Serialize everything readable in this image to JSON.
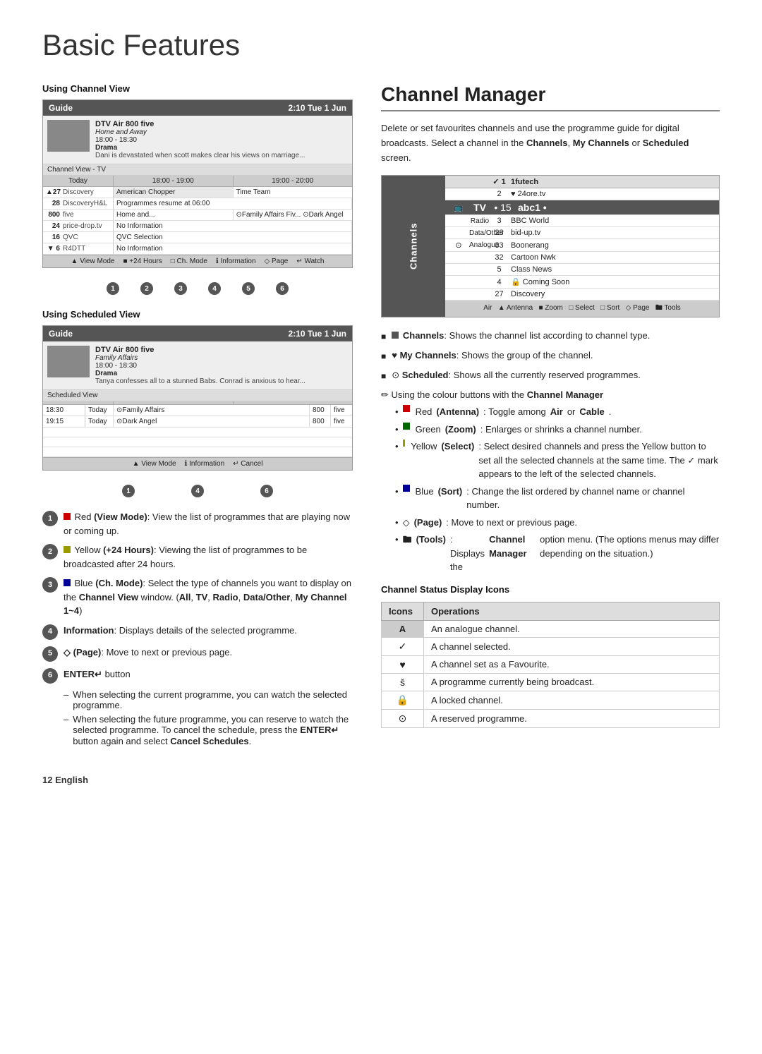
{
  "page": {
    "title": "Basic Features",
    "footer": "12  English"
  },
  "left": {
    "channel_view_label": "Using Channel View",
    "scheduled_view_label": "Using Scheduled View",
    "guide_header": "Guide",
    "guide_time": "2:10 Tue 1 Jun",
    "channel_view_source": "Channel View - TV",
    "time_today": "Today",
    "time1": "18:00 - 19:00",
    "time2": "19:00 - 20:00",
    "channels": [
      {
        "num": "▲ 27",
        "name": "Discovery",
        "prog1": "American Chopper",
        "prog2": "Time Team"
      },
      {
        "num": "28",
        "name": "DiscoveryH&L",
        "prog1": "Programmes resume at 06:00",
        "prog2": ""
      },
      {
        "num": "800",
        "name": "five",
        "prog1": "Home and...",
        "prog2": "⊙Family Affairs  Fiv...  ⊙Dark Angel"
      },
      {
        "num": "24",
        "name": "price-drop.tv",
        "prog1": "No Information",
        "prog2": ""
      },
      {
        "num": "16",
        "name": "QVC",
        "prog1": "QVC Selection",
        "prog2": ""
      },
      {
        "num": "▼  6",
        "name": "R4DTT",
        "prog1": "No Information",
        "prog2": ""
      }
    ],
    "guide_preview": {
      "title": "DTV Air 800 five",
      "subtitle1": "Home and Away",
      "subtitle2": "18:00 - 18:30",
      "category": "Drama",
      "desc": "Dani is devastated when scott makes clear his views on marriage..."
    },
    "guide_footer_items": [
      "▲ View Mode",
      "■ +24 Hours",
      "□ Ch. Mode",
      "ℹ Information",
      "◇ Page",
      "↵ Watch"
    ],
    "scheduled_preview": {
      "title": "DTV Air 800 five",
      "subtitle1": "Family Affairs",
      "subtitle2": "18:00 - 18:30",
      "category": "Drama",
      "desc": "Tanya confesses all to a stunned Babs. Conrad is anxious to hear..."
    },
    "scheduled_source": "Scheduled View",
    "scheduled_rows": [
      {
        "time": "18:30",
        "day": "Today",
        "prog": "⊙Family Affairs",
        "ch": "800",
        "network": "five"
      },
      {
        "time": "19:15",
        "day": "Today",
        "prog": "⊙Dark Angel",
        "ch": "800",
        "network": "five"
      }
    ],
    "scheduled_footer_items": [
      "▲ View Mode",
      "ℹ Information",
      "↵ Cancel"
    ],
    "bullets": [
      {
        "num": "1",
        "color_sq": "red",
        "text": "Red (View Mode): View the list of programmes that are playing now or coming up."
      },
      {
        "num": "2",
        "color_sq": "yellow",
        "text": "Yellow (+24 Hours): Viewing the list of programmes to be broadcasted after 24 hours."
      },
      {
        "num": "3",
        "color_sq": "blue",
        "text": "Blue (Ch. Mode): Select the type of channels you want to display on the Channel View window. (All, TV, Radio, Data/Other, My Channel 1~4)"
      },
      {
        "num": "4",
        "color_sq": null,
        "text": "Information: Displays details of the selected programme."
      },
      {
        "num": "5",
        "color_sq": null,
        "text": "◇ (Page): Move to next or previous page."
      },
      {
        "num": "6",
        "color_sq": null,
        "text": "ENTER↵ button"
      }
    ],
    "enter_bullets": [
      "When selecting the current programme, you can watch the selected programme.",
      "When selecting the future programme, you can reserve to watch the selected programme. To cancel the schedule, press the ENTER↵ button again and select Cancel Schedules."
    ]
  },
  "right": {
    "cm_title": "Channel Manager",
    "cm_desc": "Delete or set favourites channels and use the programme guide for digital broadcasts. Select a channel in the",
    "cm_desc2": "Channels, My Channels or Scheduled screen.",
    "cm_channels_label": "Channels",
    "cm_my_channels_label": "My Channels",
    "cm_scheduled_label": "Scheduled",
    "cm_ui": {
      "sidebar_label": "Channels",
      "header": {
        "col1": "",
        "col2": "✓ 1",
        "col3": "",
        "col4": "1futech"
      },
      "rows": [
        {
          "col1": "",
          "col2": "2",
          "col3": "",
          "col4": "♥ 24ore.tv",
          "selected": false
        },
        {
          "col1": "📺",
          "col2": "TV",
          "col3": "• 15",
          "col4": "abc1 •",
          "selected": true
        },
        {
          "col1": "",
          "col2": "Radio",
          "col3": "3",
          "col4": "BBC World",
          "selected": false
        },
        {
          "col1": "",
          "col2": "Data/Other",
          "col3": "23",
          "col4": "bid-up.tv",
          "selected": false
        },
        {
          "col1": "⊙",
          "col2": "Analogue",
          "col3": "33",
          "col4": "Boonerang",
          "selected": false
        },
        {
          "col1": "",
          "col2": "",
          "col3": "32",
          "col4": "Cartoon Nwk",
          "selected": false
        },
        {
          "col1": "",
          "col2": "",
          "col3": "5",
          "col4": "Class News",
          "selected": false
        },
        {
          "col1": "",
          "col2": "",
          "col3": "4",
          "col4": "🔒 Coming Soon",
          "selected": false
        },
        {
          "col1": "",
          "col2": "",
          "col3": "27",
          "col4": "Discovery",
          "selected": false
        }
      ],
      "footer": "Air   ▲ Antenna  ■ Zoom  □ Select  □ Sort  ◇ Page  🖿 Tools"
    },
    "bullets": [
      "Channels: Shows the channel list according to channel type.",
      "♥ My Channels: Shows the group of the channel.",
      "⊙ Scheduled: Shows all the currently reserved programmes."
    ],
    "color_usage_label": "Using the colour buttons with the Channel Manager",
    "color_bullets": [
      "■ Red (Antenna): Toggle among Air or Cable.",
      "□ Green (Zoom): Enlarges or shrinks a channel number.",
      "□ Yellow (Select): Select desired channels and press the Yellow button to set all the selected channels at the same time. The ✓ mark appears to the left of the selected channels.",
      "□ Blue (Sort): Change the list ordered by channel name or channel number.",
      "◇ (Page): Move to next or previous page.",
      "🖿 (Tools): Displays the Channel Manager option menu. (The options menus may differ depending on the situation.)"
    ],
    "status_section_label": "Channel Status Display Icons",
    "status_table_headers": [
      "Icons",
      "Operations"
    ],
    "status_rows": [
      {
        "icon": "A",
        "operation": "An analogue channel."
      },
      {
        "icon": "✓",
        "operation": "A channel selected."
      },
      {
        "icon": "♥",
        "operation": "A channel set as a Favourite."
      },
      {
        "icon": "š",
        "operation": "A programme currently being broadcast."
      },
      {
        "icon": "🔒",
        "operation": "A locked channel."
      },
      {
        "icon": "⊙",
        "operation": "A reserved programme."
      }
    ]
  }
}
